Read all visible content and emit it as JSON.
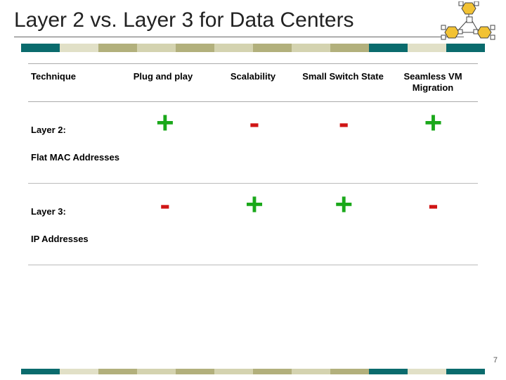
{
  "title": "Layer 2 vs. Layer 3 for Data Centers",
  "columns": [
    "Technique",
    "Plug and play",
    "Scalability",
    "Small Switch State",
    "Seamless VM Migration"
  ],
  "rows": [
    {
      "label_line1": "Layer 2:",
      "label_line2": "Flat MAC Addresses",
      "marks": [
        "+",
        "-",
        "-",
        "+"
      ]
    },
    {
      "label_line1": "Layer 3:",
      "label_line2": "IP Addresses",
      "marks": [
        "-",
        "+",
        "+",
        "-"
      ]
    }
  ],
  "page_number": "7",
  "chart_data": {
    "type": "table",
    "title": "Layer 2 vs. Layer 3 for Data Centers",
    "columns": [
      "Technique",
      "Plug and play",
      "Scalability",
      "Small Switch State",
      "Seamless VM Migration"
    ],
    "rows": [
      {
        "Technique": "Layer 2: Flat MAC Addresses",
        "Plug and play": "+",
        "Scalability": "-",
        "Small Switch State": "-",
        "Seamless VM Migration": "+"
      },
      {
        "Technique": "Layer 3: IP Addresses",
        "Plug and play": "-",
        "Scalability": "+",
        "Small Switch State": "+",
        "Seamless VM Migration": "-"
      }
    ]
  }
}
